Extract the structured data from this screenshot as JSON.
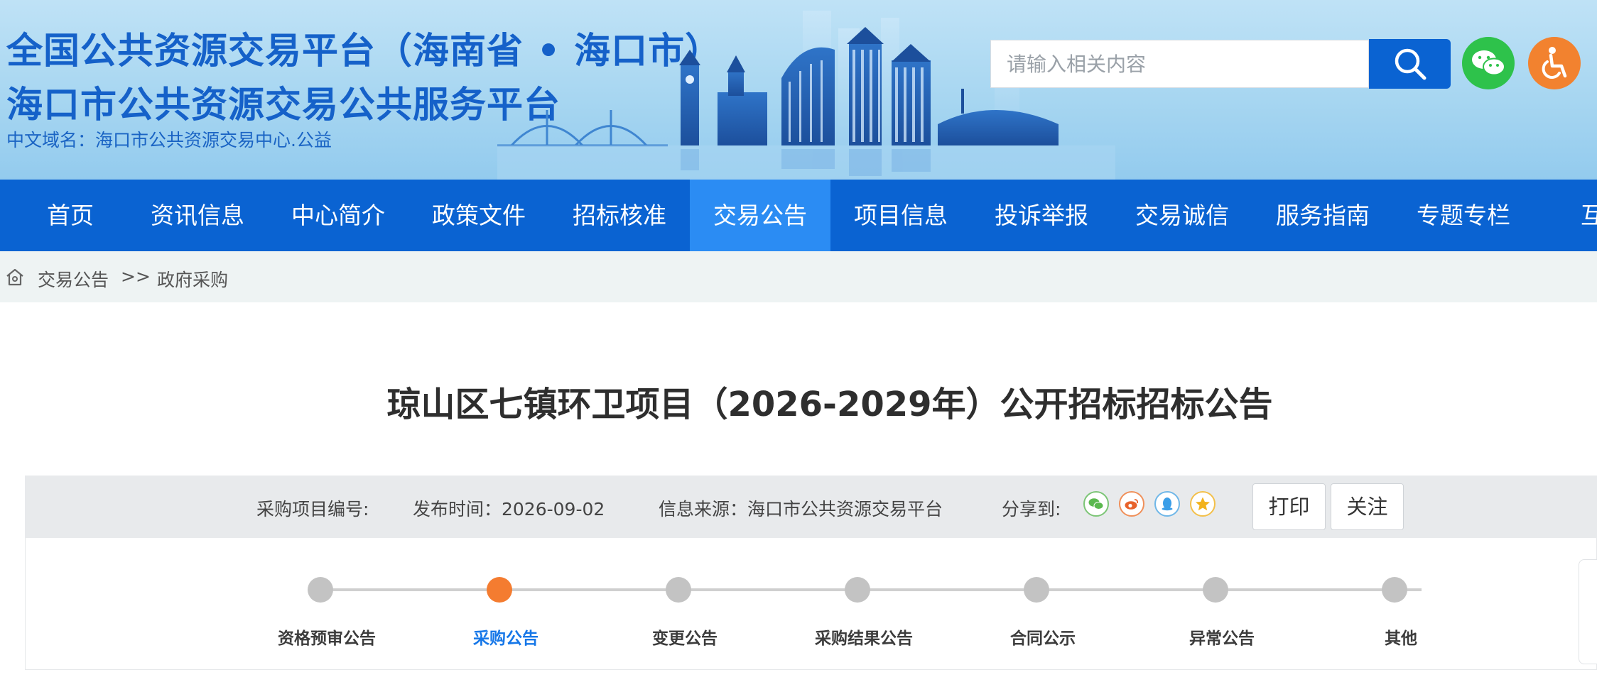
{
  "header": {
    "title_line1": "全国公共资源交易平台（海南省 • 海口市）",
    "title_line2": "海口市公共资源交易公共服务平台",
    "domain": "中文域名：海口市公共资源交易中心.公益",
    "search_placeholder": "请输入相关内容",
    "icons": {
      "search": "search-icon",
      "wechat": "wechat-icon",
      "accessibility": "accessibility-icon"
    },
    "colors": {
      "brand_blue": "#0a63d2",
      "wechat_green": "#2ec24b",
      "access_orange": "#f2822f"
    }
  },
  "nav": {
    "items": [
      "首页",
      "资讯信息",
      "中心简介",
      "政策文件",
      "招标核准",
      "交易公告",
      "项目信息",
      "投诉举报",
      "交易诚信",
      "服务指南",
      "专题专栏",
      "互动"
    ],
    "active": "交易公告"
  },
  "breadcrumb": {
    "items": [
      "交易公告",
      "政府采购"
    ],
    "separator": ">>"
  },
  "article": {
    "title": "琼山区七镇环卫项目（2026-2029年）公开招标招标公告"
  },
  "info": {
    "project_no_label": "采购项目编号:",
    "publish_time": "发布时间：2026-09-02",
    "source": "信息来源：海口市公共资源交易平台",
    "share_label": "分享到:",
    "print": "打印",
    "follow": "关注"
  },
  "timeline": {
    "steps": [
      "资格预审公告",
      "采购公告",
      "变更公告",
      "采购结果公告",
      "合同公示",
      "异常公告",
      "其他"
    ],
    "active_index": 1,
    "colors": {
      "active": "#f47c30",
      "inactive": "#c3c3c3",
      "active_text": "#1677e8"
    }
  }
}
